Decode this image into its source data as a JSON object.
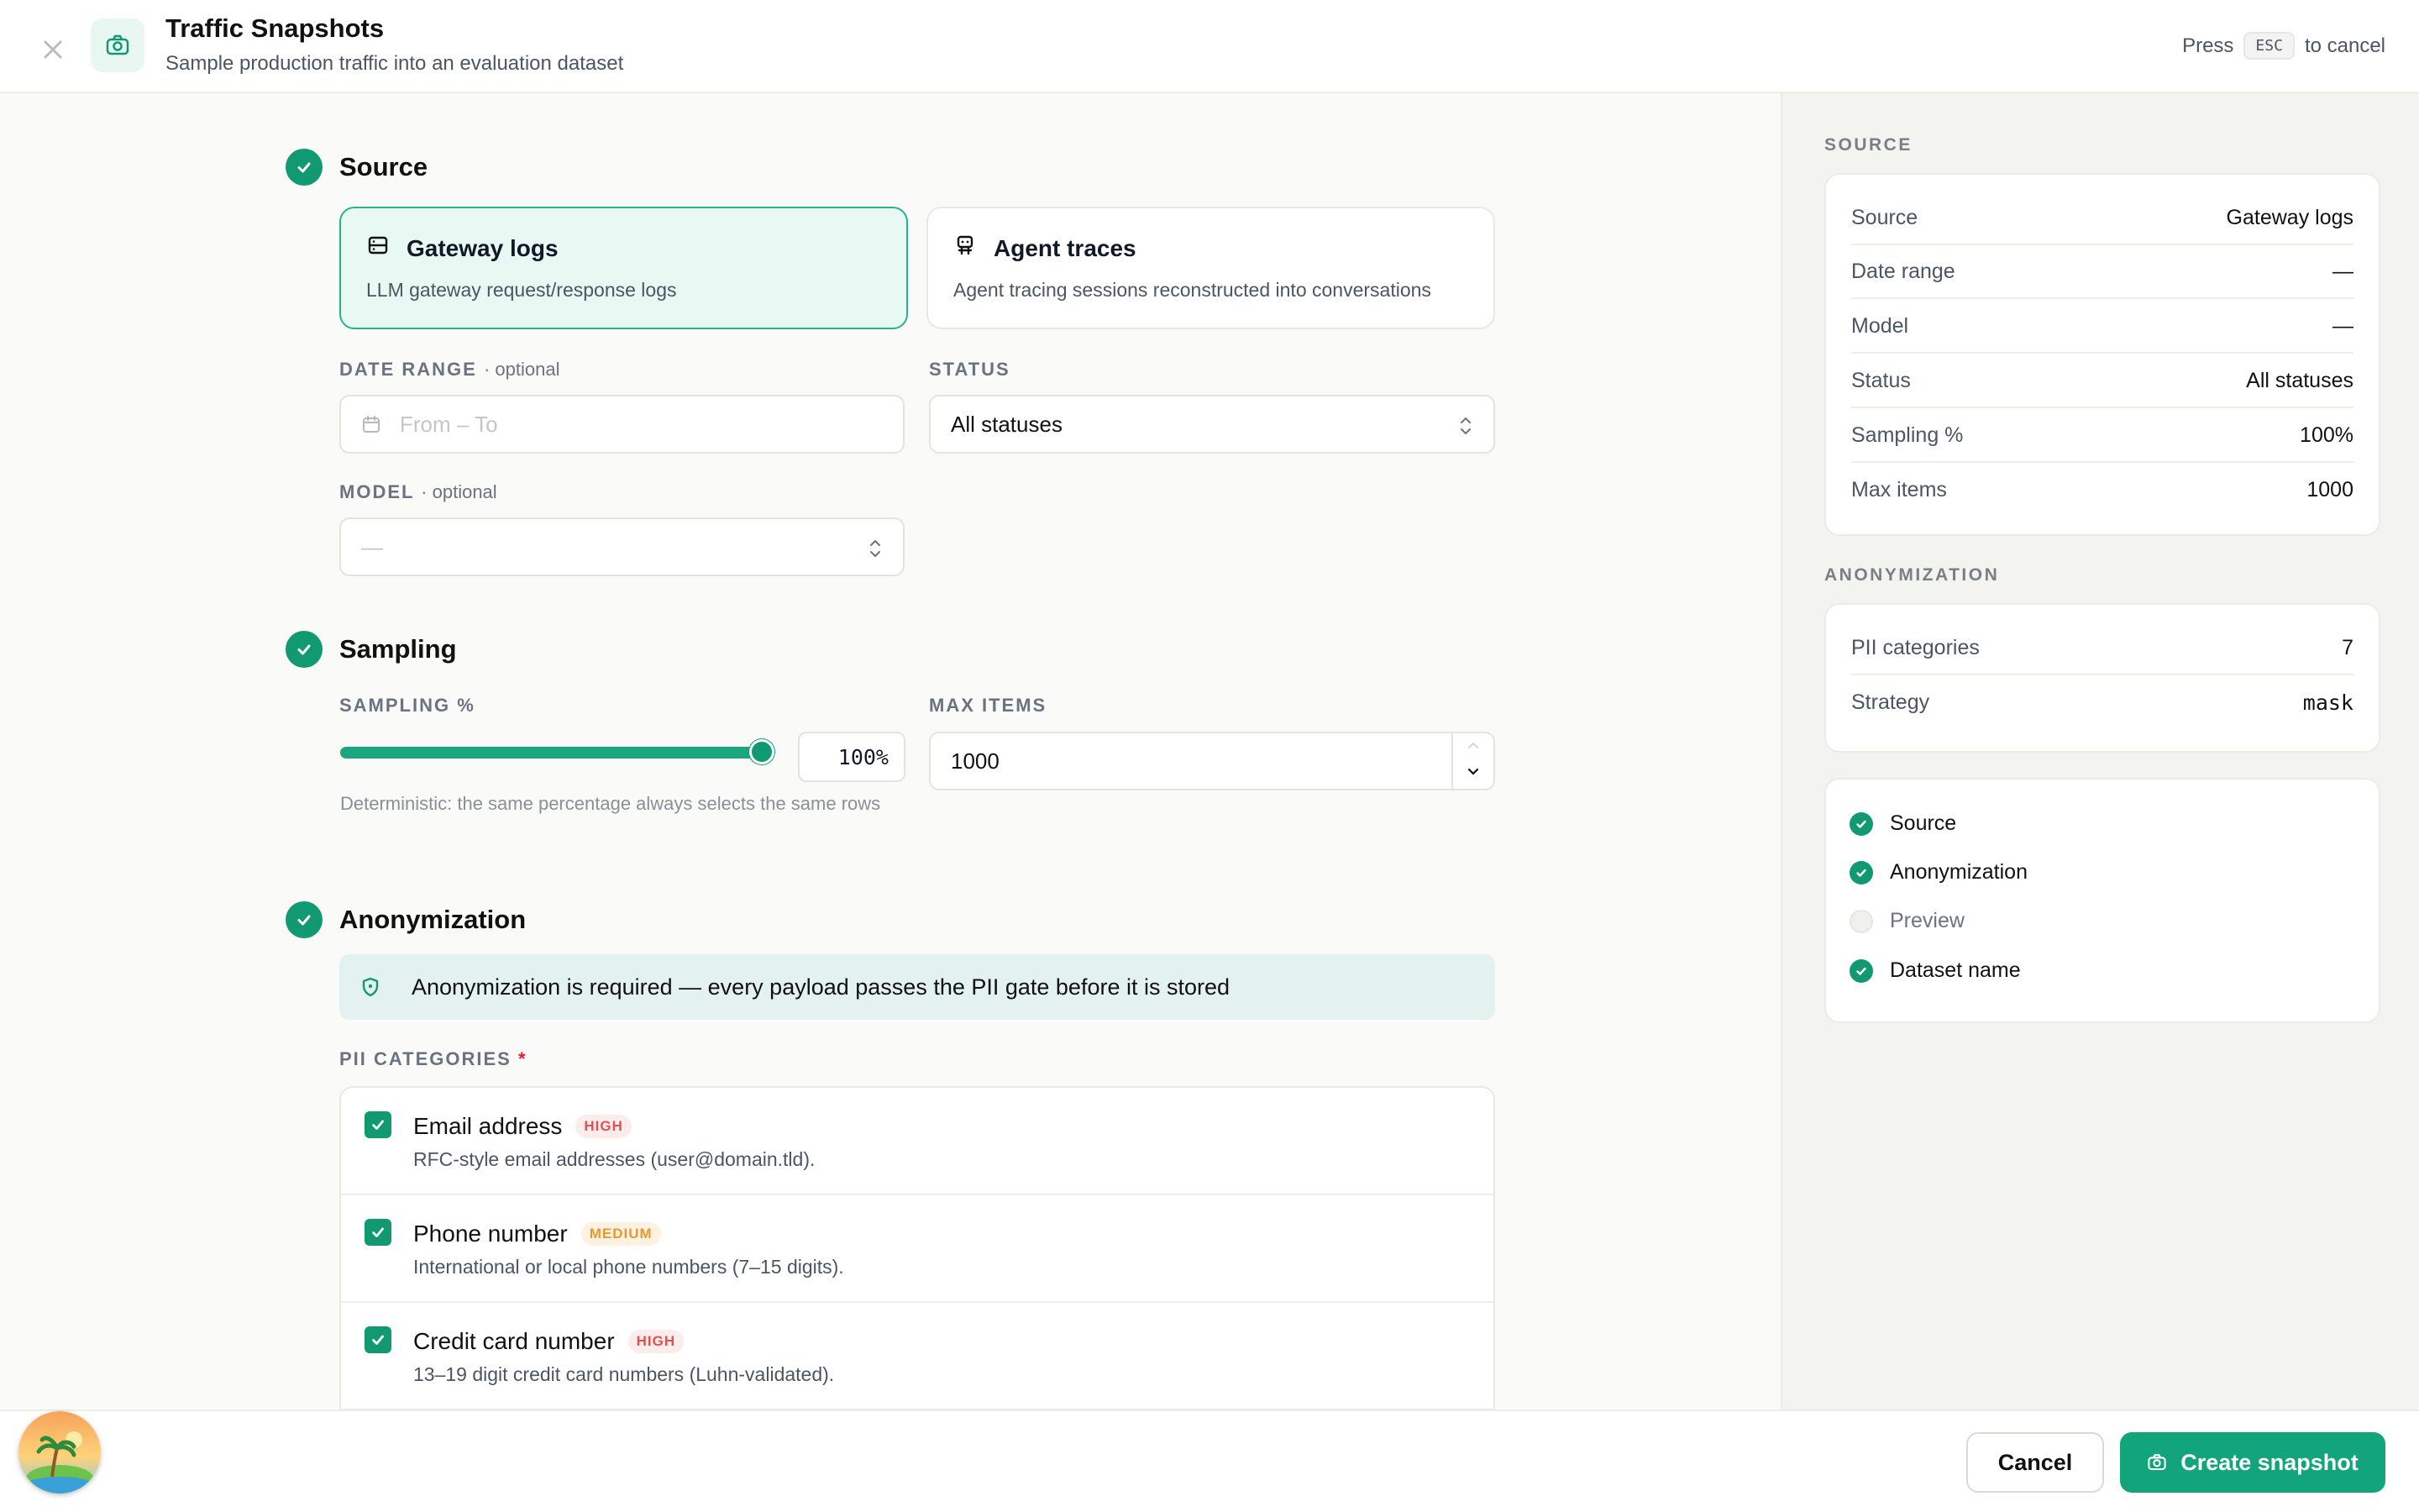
{
  "header": {
    "title": "Traffic Snapshots",
    "subtitle": "Sample production traffic into an evaluation dataset",
    "esc_prefix": "Press",
    "esc_key": "ESC",
    "esc_suffix": "to cancel"
  },
  "source": {
    "heading": "Source",
    "options": [
      {
        "title": "Gateway logs",
        "desc": "LLM gateway request/response logs",
        "selected": true,
        "icon": "server-icon"
      },
      {
        "title": "Agent traces",
        "desc": "Agent tracing sessions reconstructed into conversations",
        "selected": false,
        "icon": "robot-icon"
      }
    ],
    "date_range": {
      "label": "DATE RANGE",
      "optional": "· optional",
      "placeholder": "From – To"
    },
    "status": {
      "label": "STATUS",
      "value": "All statuses"
    },
    "model": {
      "label": "MODEL",
      "optional": "· optional",
      "value": "—"
    }
  },
  "sampling": {
    "heading": "Sampling",
    "percent_label": "SAMPLING %",
    "percent_value": "100%",
    "percent_fraction": 1.0,
    "help": "Deterministic: the same percentage always selects the same rows",
    "max_label": "MAX ITEMS",
    "max_value": "1000"
  },
  "anonymization": {
    "heading": "Anonymization",
    "banner": "Anonymization is required — every payload passes the PII gate before it is stored",
    "pii_label": "PII CATEGORIES",
    "pii_required": "*",
    "categories": [
      {
        "name": "Email address",
        "level": "HIGH",
        "desc": "RFC-style email addresses (user@domain.tld).",
        "checked": true
      },
      {
        "name": "Phone number",
        "level": "MEDIUM",
        "desc": "International or local phone numbers (7–15 digits).",
        "checked": true
      },
      {
        "name": "Credit card number",
        "level": "HIGH",
        "desc": "13–19 digit credit card numbers (Luhn-validated).",
        "checked": true
      }
    ]
  },
  "summary": {
    "source_label": "SOURCE",
    "source_rows": [
      {
        "k": "Source",
        "v": "Gateway logs"
      },
      {
        "k": "Date range",
        "v": "—"
      },
      {
        "k": "Model",
        "v": "—"
      },
      {
        "k": "Status",
        "v": "All statuses"
      },
      {
        "k": "Sampling %",
        "v": "100%"
      },
      {
        "k": "Max items",
        "v": "1000"
      }
    ],
    "anon_label": "ANONYMIZATION",
    "anon_rows": [
      {
        "k": "PII categories",
        "v": "7"
      },
      {
        "k": "Strategy",
        "v": "mask"
      }
    ],
    "steps": [
      {
        "label": "Source",
        "done": true
      },
      {
        "label": "Anonymization",
        "done": true
      },
      {
        "label": "Preview",
        "done": false
      },
      {
        "label": "Dataset name",
        "done": true
      }
    ]
  },
  "footer": {
    "cancel": "Cancel",
    "create": "Create snapshot"
  },
  "colors": {
    "accent": "#119a72",
    "accent_light": "#e8f8f2",
    "high": "#e05252",
    "medium": "#e39a33"
  }
}
